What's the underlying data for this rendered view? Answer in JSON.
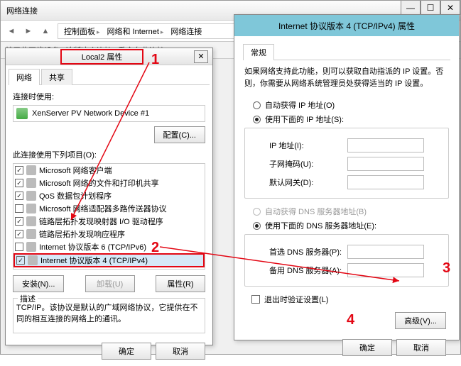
{
  "bg": {
    "title": "网络连接",
    "crumbs": [
      "控制面板",
      "网络和 Internet",
      "网络连接"
    ],
    "toolbar": [
      "禁用此网络设备",
      "诊断这个连接",
      "重命名此连接"
    ]
  },
  "dlg1": {
    "title": "Local2 属性",
    "tab_net": "网络",
    "tab_share": "共享",
    "conn_label": "连接时使用:",
    "device": "XenServer PV Network Device #1",
    "configure": "配置(C)...",
    "items_label": "此连接使用下列项目(O):",
    "items": [
      {
        "chk": true,
        "label": "Microsoft 网络客户端"
      },
      {
        "chk": true,
        "label": "Microsoft 网络的文件和打印机共享"
      },
      {
        "chk": true,
        "label": "QoS 数据包计划程序"
      },
      {
        "chk": false,
        "label": "Microsoft 网络适配器多路传送器协议"
      },
      {
        "chk": true,
        "label": "链路层拓扑发现映射器 I/O 驱动程序"
      },
      {
        "chk": true,
        "label": "链路层拓扑发现响应程序"
      },
      {
        "chk": false,
        "label": "Internet 协议版本 6 (TCP/IPv6)"
      },
      {
        "chk": true,
        "label": "Internet 协议版本 4 (TCP/IPv4)"
      }
    ],
    "install": "安装(N)...",
    "uninstall": "卸载(U)",
    "props": "属性(R)",
    "desc_legend": "描述",
    "desc": "TCP/IP。该协议是默认的广域网络协议，它提供在不同的相互连接的网络上的通讯。",
    "ok": "确定",
    "cancel": "取消"
  },
  "dlg2": {
    "title": "Internet 协议版本 4 (TCP/IPv4) 属性",
    "tab_general": "常规",
    "intro": "如果网络支持此功能，则可以获取自动指派的 IP 设置。否则，你需要从网络系统管理员处获得适当的 IP 设置。",
    "auto_ip": "自动获得 IP 地址(O)",
    "use_ip": "使用下面的 IP 地址(S):",
    "ip_lbl": "IP 地址(I):",
    "mask_lbl": "子网掩码(U):",
    "gw_lbl": "默认网关(D):",
    "auto_dns": "自动获得 DNS 服务器地址(B)",
    "use_dns": "使用下面的 DNS 服务器地址(E):",
    "dns1_lbl": "首选 DNS 服务器(P):",
    "dns2_lbl": "备用 DNS 服务器(A):",
    "validate": "退出时验证设置(L)",
    "advanced": "高级(V)...",
    "ok": "确定",
    "cancel": "取消"
  },
  "annotations": {
    "a1": "1",
    "a2": "2",
    "a3": "3",
    "a4": "4"
  }
}
